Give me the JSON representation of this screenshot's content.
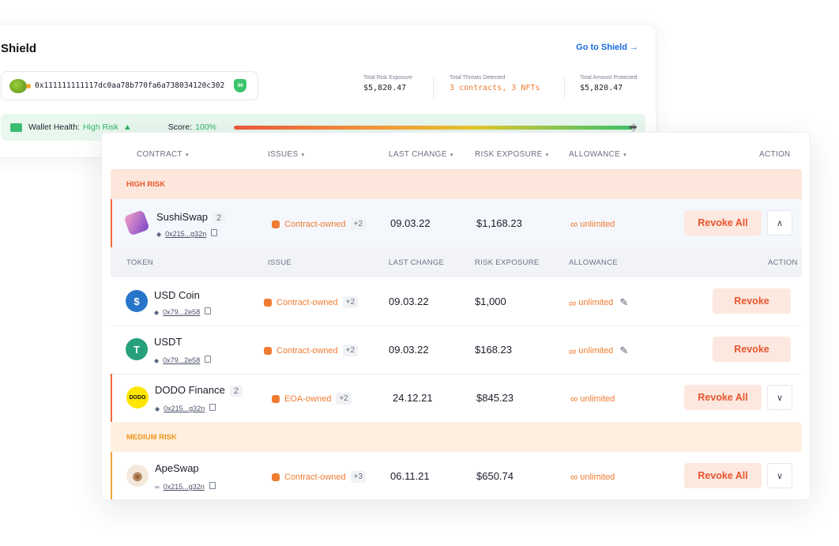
{
  "back_panel": {
    "title": "Shield",
    "go_link": "Go to Shield →",
    "wallet_address": "0x111111111117dc0aa78b770fa6a738034120c302",
    "shield_score": "99",
    "stats": [
      {
        "label": "Total Risk Exposure",
        "value": "$5,820.47",
        "color": "#1a1d29"
      },
      {
        "label": "Total Threats Detected",
        "value": "3 contracts, 3 NFTs",
        "color": "#f07c32"
      },
      {
        "label": "Total Amount Protected",
        "value": "$5,820.47",
        "color": "#1a1d29"
      }
    ],
    "health": {
      "label": "Wallet Health:",
      "value": "High Risk",
      "warn_icon": "▲",
      "score_label": "Score:",
      "score_value": "100%",
      "score_fraction": 1.0,
      "share_icon": "➦"
    }
  },
  "table": {
    "columns": [
      "CONTRACT",
      "ISSUES",
      "LAST CHANGE",
      "RISK EXPOSURE",
      "ALLOWANCE",
      "ACTION"
    ],
    "sort_caret": "▾",
    "high_risk_label": "HIGH RISK",
    "medium_risk_label": "MEDIUM RISK",
    "subheader": [
      "TOKEN",
      "ISSUE",
      "LAST CHANGE",
      "RISK EXPOSURE",
      "ALLOWANCE",
      "ACTION"
    ],
    "revoke_all_label": "Revoke All",
    "revoke_label": "Revoke",
    "allowance_icon": "∞",
    "pencil_icon": "✎",
    "chevron_up": "∧",
    "chevron_down": "∨",
    "rows": {
      "sushi": {
        "name": "SushiSwap",
        "count": "2",
        "address": "0x215...g32n",
        "issue": "Contract-owned",
        "plus": "+2",
        "date": "09.03.22",
        "exposure": "$1,168.23",
        "allowance": "unlimited"
      },
      "usdc": {
        "name": "USD Coin",
        "address": "0x79...2e58",
        "issue": "Contract-owned",
        "plus": "+2",
        "date": "09.03.22",
        "exposure": "$1,000",
        "allowance": "unlimited"
      },
      "usdt": {
        "name": "USDT",
        "address": "0x79...2e58",
        "issue": "Contract-owned",
        "plus": "+2",
        "date": "09.03.22",
        "exposure": "$168.23",
        "allowance": "unlimited"
      },
      "dodo": {
        "name": "DODO Finance",
        "count": "2",
        "address": "0x215...g32n",
        "issue": "EOA-owned",
        "plus": "+2",
        "date": "24.12.21",
        "exposure": "$845.23",
        "allowance": "unlimited",
        "logo_text": "DODO"
      },
      "ape": {
        "name": "ApeSwap",
        "address": "0x215...g32n",
        "issue": "Contract-owned",
        "plus": "+3",
        "date": "06.11.21",
        "exposure": "$650.74",
        "allowance": "unlimited"
      }
    },
    "coin_glyphs": {
      "usdc": "$",
      "usdt": "T",
      "ape": "◉",
      "sushi": "",
      "eth": "◆",
      "link": "∞"
    }
  },
  "colors": {
    "accent_blue": "#1a6bdf",
    "risk_orange": "#f07c32",
    "health_green": "#2eb466"
  }
}
